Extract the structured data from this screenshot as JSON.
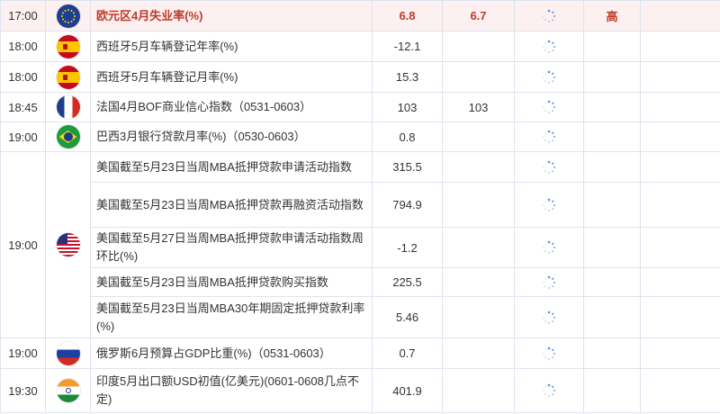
{
  "rows": [
    {
      "time": "17:00",
      "country": "eu",
      "indicator": "欧元区4月失业率(%)",
      "actual": "6.8",
      "forecast": "6.7",
      "importance": "高",
      "highlight": true
    },
    {
      "time": "18:00",
      "country": "es",
      "indicator": "西班牙5月车辆登记年率(%)",
      "actual": "-12.1",
      "forecast": "",
      "importance": ""
    },
    {
      "time": "18:00",
      "country": "es",
      "indicator": "西班牙5月车辆登记月率(%)",
      "actual": "15.3",
      "forecast": "",
      "importance": ""
    },
    {
      "time": "18:45",
      "country": "fr",
      "indicator": "法国4月BOF商业信心指数（0531-0603）",
      "actual": "103",
      "forecast": "103",
      "importance": ""
    },
    {
      "time": "19:00",
      "country": "br",
      "indicator": "巴西3月银行贷款月率(%)（0530-0603）",
      "actual": "0.8",
      "forecast": "",
      "importance": ""
    },
    {
      "time": "19:00",
      "country": "us",
      "indicator": "美国截至5月23日当周MBA抵押贷款申请活动指数",
      "actual": "315.5",
      "forecast": "",
      "importance": ""
    },
    {
      "time": "",
      "country": "us",
      "indicator": "美国截至5月23日当周MBA抵押贷款再融资活动指数",
      "actual": "794.9",
      "forecast": "",
      "importance": ""
    },
    {
      "time": "",
      "country": "us",
      "indicator": "美国截至5月27日当周MBA抵押贷款申请活动指数周环比(%)",
      "actual": "-1.2",
      "forecast": "",
      "importance": ""
    },
    {
      "time": "",
      "country": "us",
      "indicator": "美国截至5月23日当周MBA抵押贷款购买指数",
      "actual": "225.5",
      "forecast": "",
      "importance": ""
    },
    {
      "time": "",
      "country": "us",
      "indicator": "美国截至5月23日当周MBA30年期固定抵押贷款利率(%)",
      "actual": "5.46",
      "forecast": "",
      "importance": ""
    },
    {
      "time": "19:00",
      "country": "ru",
      "indicator": "俄罗斯6月预算占GDP比重(%)（0531-0603）",
      "actual": "0.7",
      "forecast": "",
      "importance": ""
    },
    {
      "time": "19:30",
      "country": "in",
      "indicator": "印度5月出口额USD初值(亿美元)(0601-0608几点不定)",
      "actual": "401.9",
      "forecast": "",
      "importance": ""
    }
  ]
}
